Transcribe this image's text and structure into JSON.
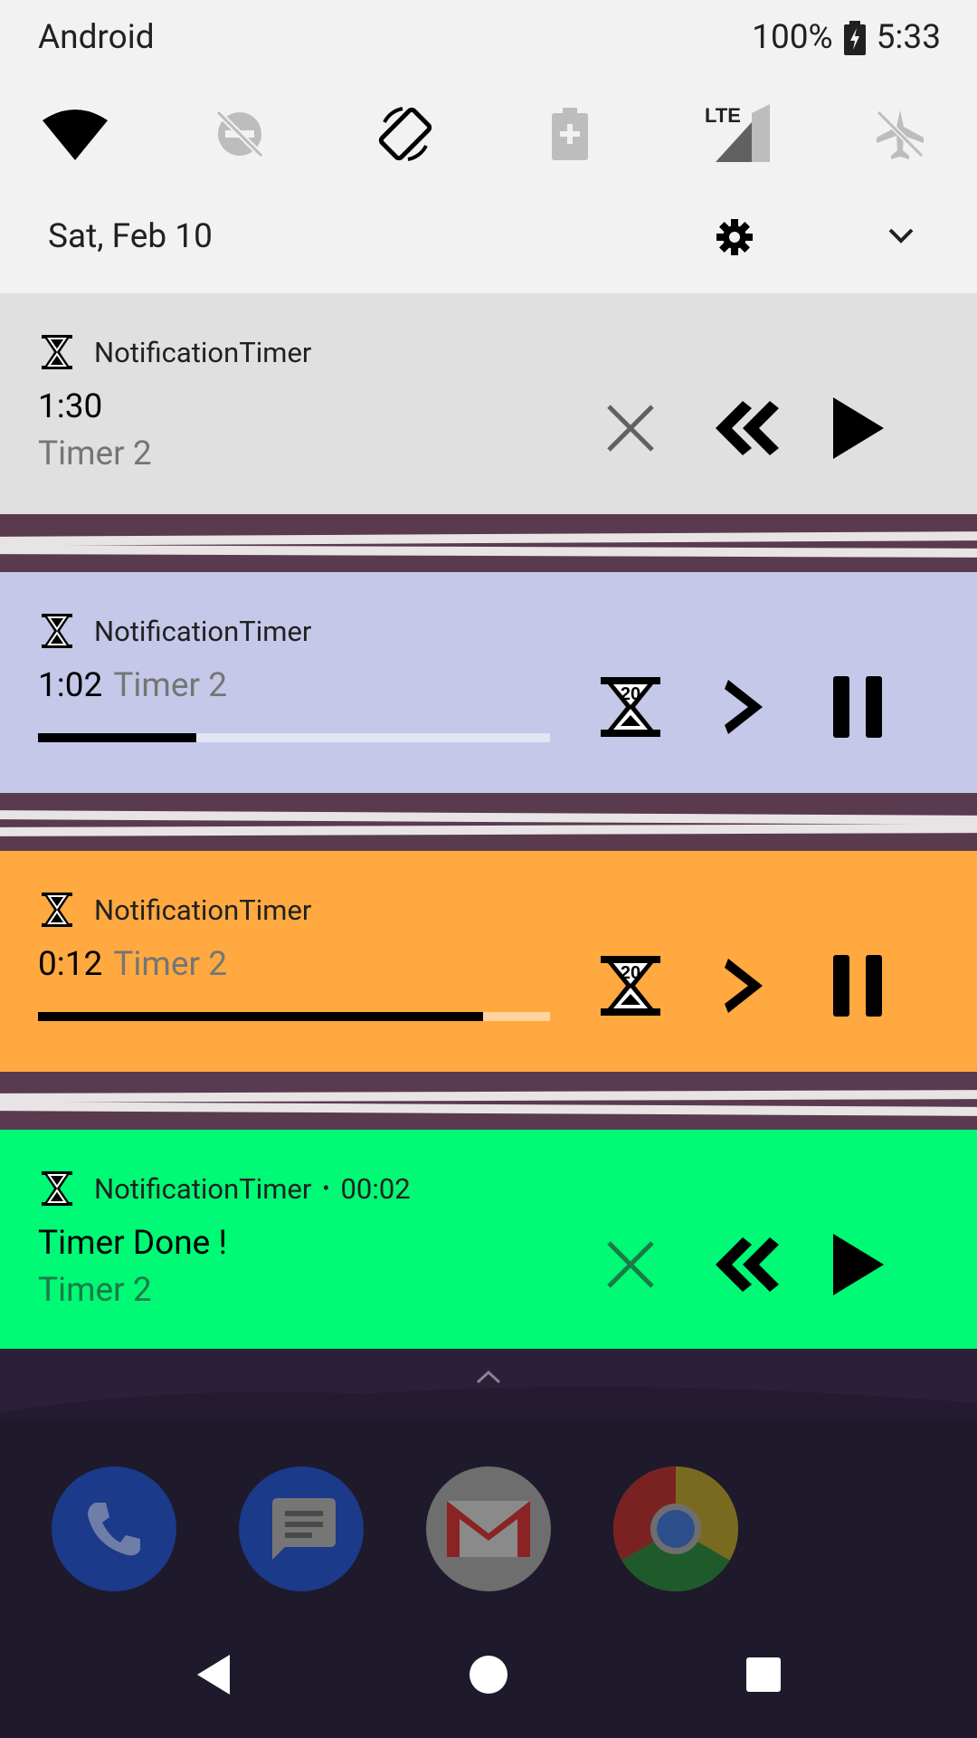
{
  "status_bar": {
    "carrier": "Android",
    "battery": "100%",
    "time": "5:33"
  },
  "quick_settings": {
    "tiles": [
      "wifi-icon",
      "do-not-disturb-off-icon",
      "auto-rotate-icon",
      "battery-saver-icon",
      "lte-signal-icon",
      "airplane-mode-icon"
    ],
    "date": "Sat, Feb 10"
  },
  "notifications": [
    {
      "app": "NotificationTimer",
      "title": "1:30",
      "subtitle": "Timer 2",
      "background": "#e0e0e0",
      "actions": [
        "close-icon",
        "rewind-icon",
        "play-icon"
      ]
    },
    {
      "app": "NotificationTimer",
      "title": "1:02",
      "subtitle": "Timer 2",
      "background": "#c5c8e8",
      "progress": 0.31,
      "actions": [
        "add-20-icon",
        "next-icon",
        "pause-icon"
      ]
    },
    {
      "app": "NotificationTimer",
      "title": "0:12",
      "subtitle": "Timer 2",
      "background": "#ffa940",
      "progress": 0.87,
      "actions": [
        "add-20-icon",
        "next-icon",
        "pause-icon"
      ]
    },
    {
      "app": "NotificationTimer",
      "time": "00:02",
      "title": "Timer Done !",
      "subtitle": "Timer 2",
      "background": "#00f975",
      "actions": [
        "close-icon",
        "rewind-icon",
        "play-icon"
      ]
    }
  ],
  "dock": [
    "phone-icon",
    "messages-icon",
    "gmail-icon",
    "chrome-icon"
  ],
  "nav": [
    "back-icon",
    "home-icon",
    "recents-icon"
  ]
}
